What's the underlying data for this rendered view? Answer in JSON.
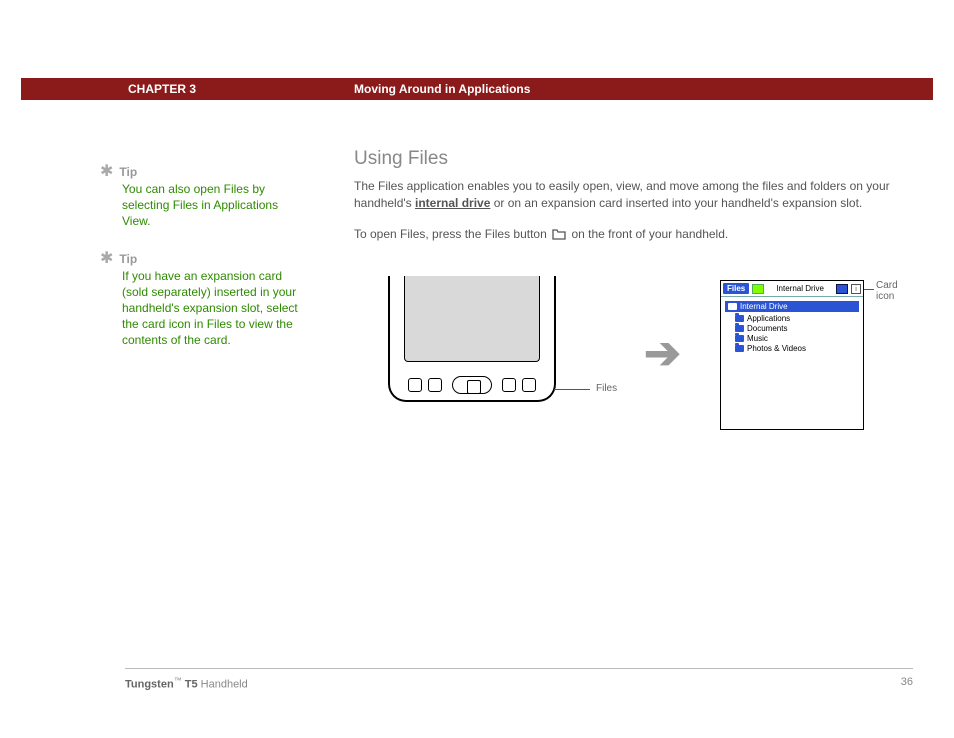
{
  "header": {
    "chapter_label": "CHAPTER 3",
    "chapter_title": "Moving Around in Applications"
  },
  "sidebar": {
    "tips": [
      {
        "label": "Tip",
        "body": "You can also open Files by selecting Files in Applications View."
      },
      {
        "label": "Tip",
        "body": "If you have an expansion card (sold separately) inserted in your handheld's expansion slot, select the card icon in Files to view the contents of the card."
      }
    ]
  },
  "main": {
    "heading": "Using Files",
    "para1_a": "The Files application enables you to easily open, view, and move among the files and folders on your handheld's ",
    "para1_link": "internal drive",
    "para1_b": " or on an expansion card inserted into your handheld's expansion slot.",
    "para2_a": "To open Files, press the Files button ",
    "para2_b": " on the front of your handheld."
  },
  "illustration": {
    "device_callout": "Files",
    "card_callout": "Card icon",
    "files_window": {
      "title_label": "Files",
      "drive_label": "Internal Drive",
      "info_char": "i",
      "selected": "Internal Drive",
      "items": [
        "Applications",
        "Documents",
        "Music",
        "Photos & Videos"
      ]
    }
  },
  "footer": {
    "product_bold": "Tungsten",
    "product_tm": "™",
    "product_model": " T5",
    "product_tail": " Handheld",
    "page_number": "36"
  }
}
